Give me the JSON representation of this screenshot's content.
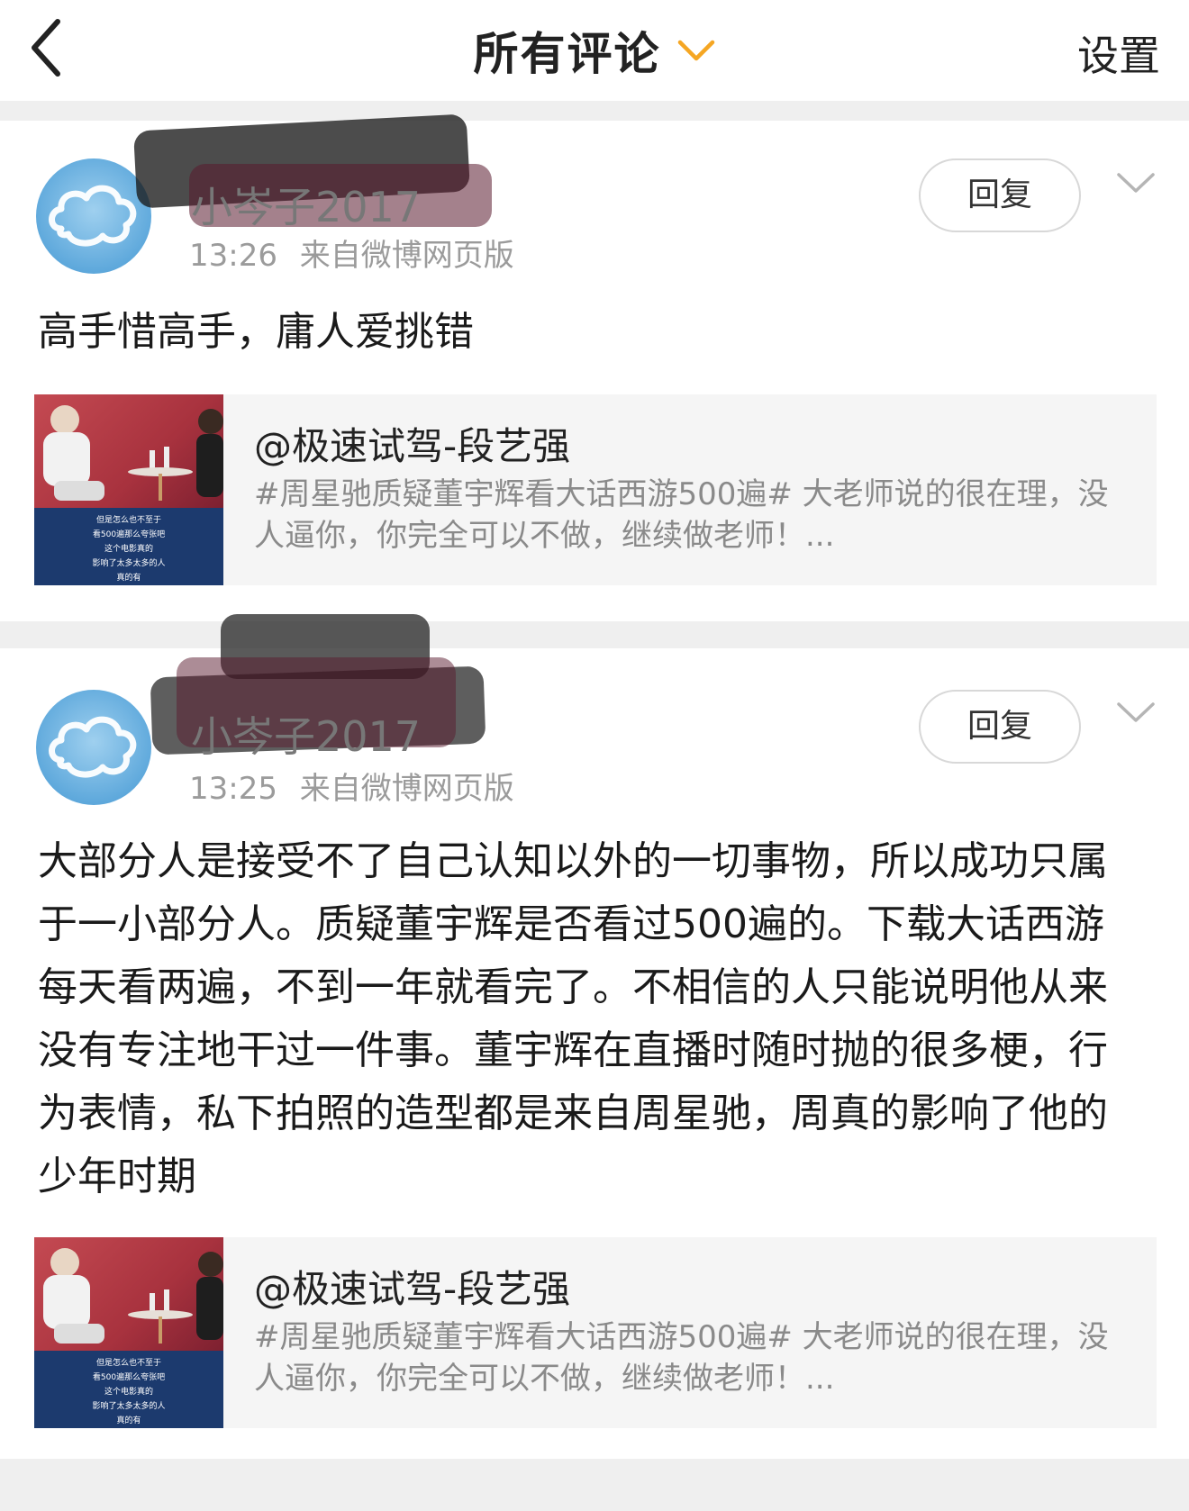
{
  "header": {
    "back_icon": "chevron-left-icon",
    "title": "所有评论",
    "title_icon": "chevron-down-icon",
    "title_icon_color": "#f5a623",
    "settings_label": "设置"
  },
  "comments": [
    {
      "username": "小岑子2017",
      "time": "13:26",
      "source": "来自微博网页版",
      "reply_label": "回复",
      "text": "高手惜高手，庸人爱挑错",
      "card": {
        "title": "@极速试驾-段艺强",
        "desc": "#周星驰质疑董宇辉看大话西游500遍# 大老师说的很在理，没人逼你，你完全可以不做，继续做老师！...",
        "thumb_caption": [
          "但是怎么也不至于",
          "看500遍那么夸张吧",
          "这个电影真的",
          "影响了太多太多的人",
          "真的有"
        ]
      }
    },
    {
      "username": "小岑子2017",
      "time": "13:25",
      "source": "来自微博网页版",
      "reply_label": "回复",
      "text": "大部分人是接受不了自己认知以外的一切事物，所以成功只属于一小部分人。质疑董宇辉是否看过500遍的。下载大话西游每天看两遍，不到一年就看完了。不相信的人只能说明他从来没有专注地干过一件事。董宇辉在直播时随时抛的很多梗，行为表情，私下拍照的造型都是来自周星驰，周真的影响了他的少年时期",
      "card": {
        "title": "@极速试驾-段艺强",
        "desc": "#周星驰质疑董宇辉看大话西游500遍# 大老师说的很在理，没人逼你，你完全可以不做，继续做老师！...",
        "thumb_caption": [
          "但是怎么也不至于",
          "看500遍那么夸张吧",
          "这个电影真的",
          "影响了太多太多的人",
          "真的有"
        ]
      }
    }
  ]
}
